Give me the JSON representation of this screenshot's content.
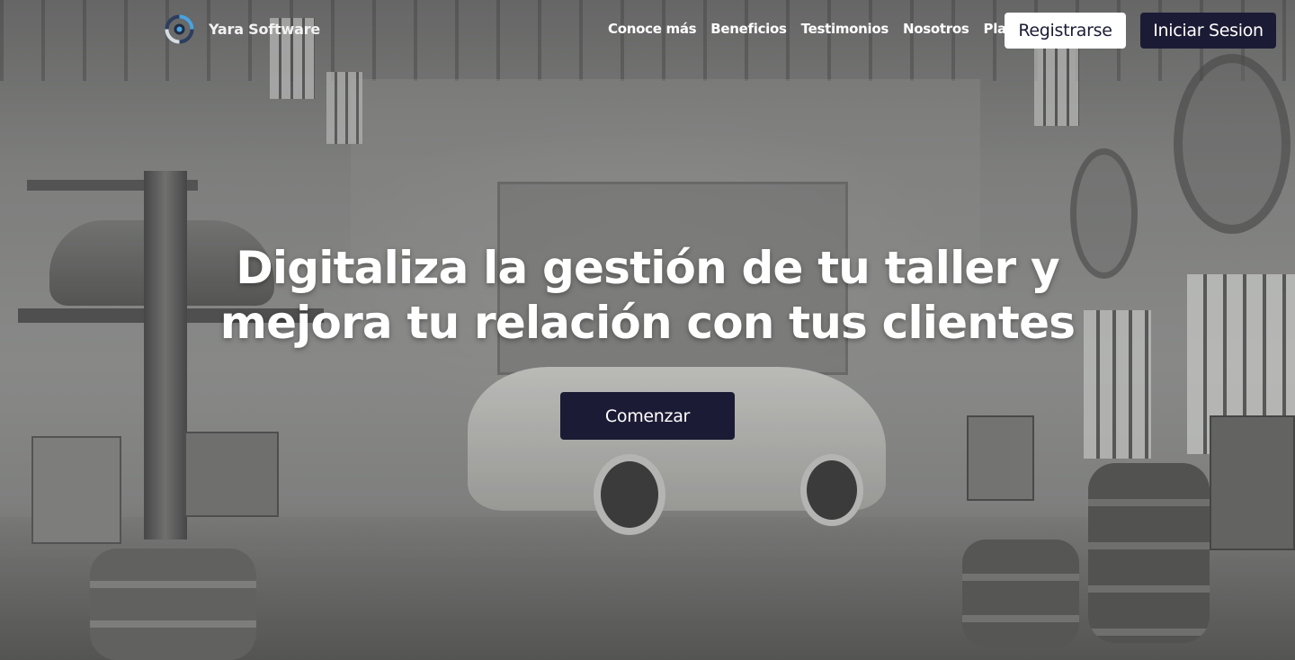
{
  "brand": {
    "name": "Yara Software",
    "logo_icon": "yara-logo-icon"
  },
  "nav": {
    "links": [
      "Conoce más",
      "Beneficios",
      "Testimonios",
      "Nosotros",
      "Plan"
    ]
  },
  "actions": {
    "register_label": "Registrarse",
    "login_label": "Iniciar Sesion"
  },
  "hero": {
    "title": "Digitaliza la gestión de tu taller y mejora tu relación con tus clientes",
    "cta_label": "Comenzar",
    "background": "garage-workshop-image"
  },
  "colors": {
    "primary_dark": "#1c1b35",
    "white": "#ffffff"
  }
}
